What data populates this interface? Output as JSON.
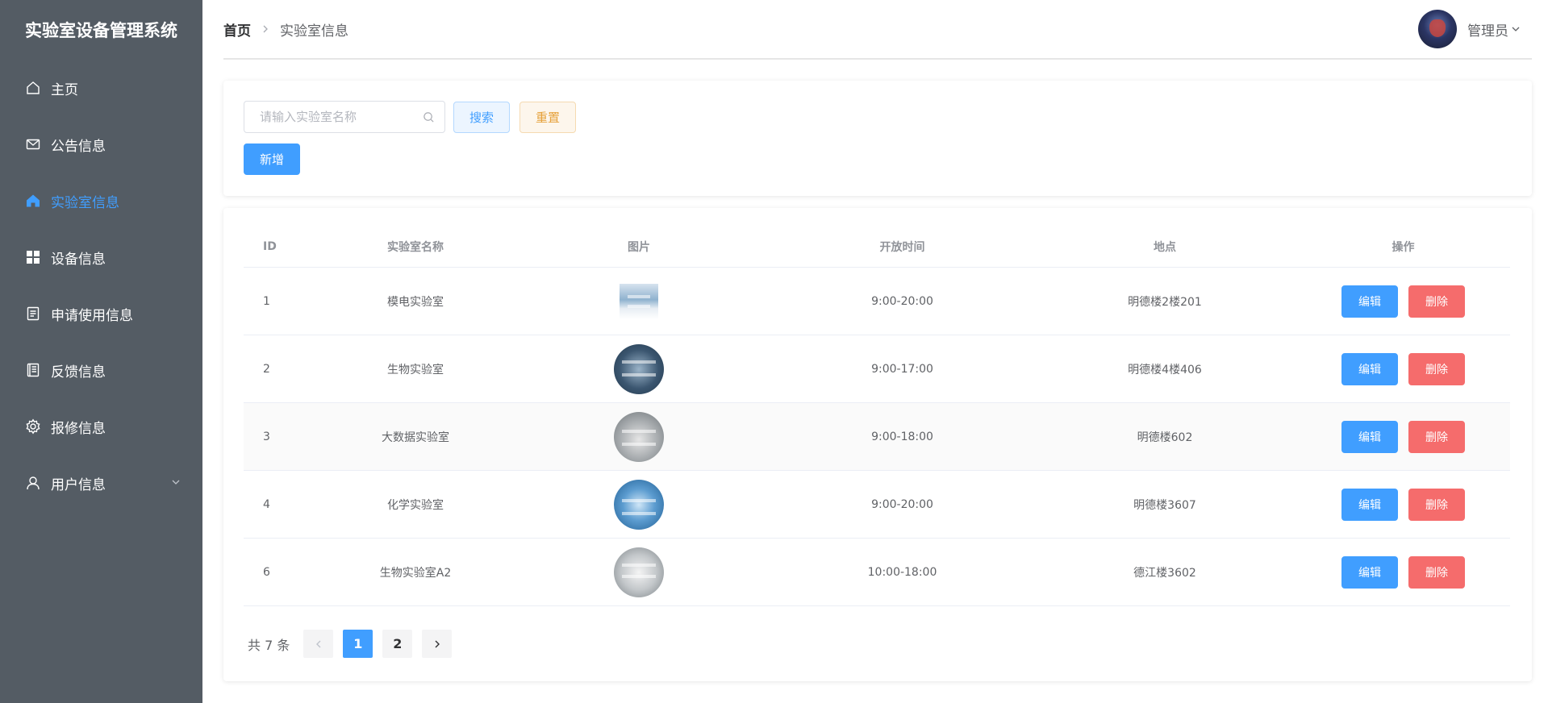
{
  "app": {
    "title": "实验室设备管理系统"
  },
  "sidebar": {
    "items": [
      {
        "label": "主页",
        "icon": "home-icon"
      },
      {
        "label": "公告信息",
        "icon": "message-icon"
      },
      {
        "label": "实验室信息",
        "icon": "house-icon",
        "active": true
      },
      {
        "label": "设备信息",
        "icon": "grid-icon"
      },
      {
        "label": "申请使用信息",
        "icon": "document-icon"
      },
      {
        "label": "反馈信息",
        "icon": "notebook-icon"
      },
      {
        "label": "报修信息",
        "icon": "gear-icon"
      },
      {
        "label": "用户信息",
        "icon": "user-icon",
        "has_submenu": true
      }
    ]
  },
  "header": {
    "breadcrumb": {
      "home": "首页",
      "current": "实验室信息"
    },
    "user": {
      "name": "管理员"
    }
  },
  "search": {
    "placeholder": "请输入实验室名称",
    "value": "",
    "search_label": "搜索",
    "reset_label": "重置",
    "add_label": "新增"
  },
  "table": {
    "columns": [
      "ID",
      "实验室名称",
      "图片",
      "开放时间",
      "地点",
      "操作"
    ],
    "rows": [
      {
        "id": "1",
        "name": "模电实验室",
        "time": "9:00-20:00",
        "location": "明德楼2楼201"
      },
      {
        "id": "2",
        "name": "生物实验室",
        "time": "9:00-17:00",
        "location": "明德楼4楼406"
      },
      {
        "id": "3",
        "name": "大数据实验室",
        "time": "9:00-18:00",
        "location": "明德楼602"
      },
      {
        "id": "4",
        "name": "化学实验室",
        "time": "9:00-20:00",
        "location": "明德楼3607"
      },
      {
        "id": "6",
        "name": "生物实验室A2",
        "time": "10:00-18:00",
        "location": "德江楼3602"
      }
    ],
    "edit_label": "编辑",
    "delete_label": "删除"
  },
  "pagination": {
    "total_text": "共 7 条",
    "pages": [
      "1",
      "2"
    ],
    "current": "1"
  },
  "colors": {
    "sidebar_bg": "#545c64",
    "accent": "#409eff",
    "danger": "#f56c6c",
    "warning": "#e6a23c"
  }
}
